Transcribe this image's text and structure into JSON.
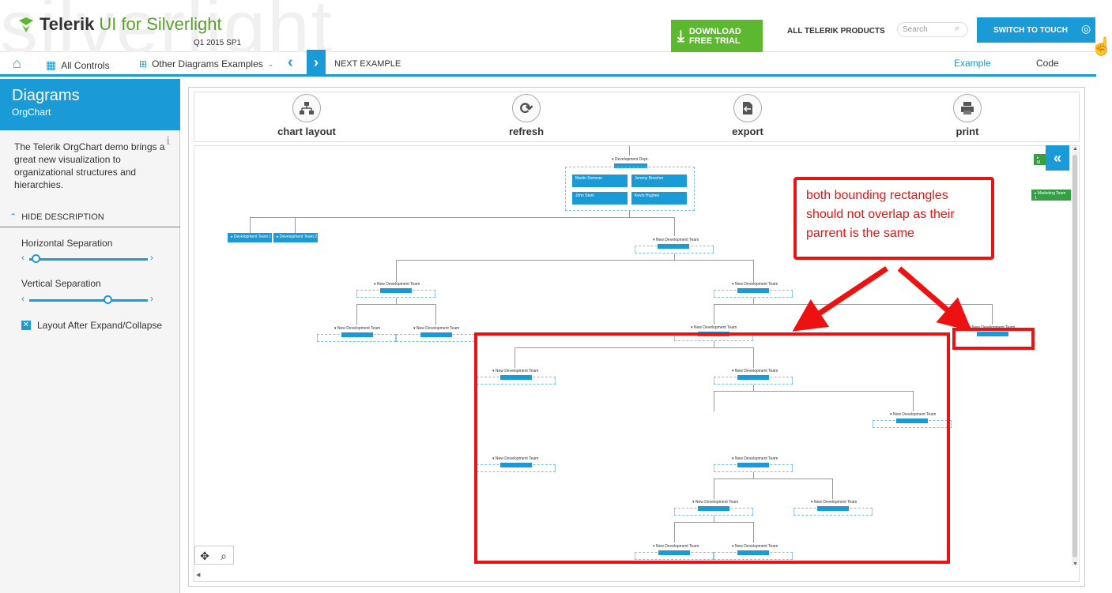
{
  "header": {
    "watermark": "silverlight",
    "brand": "Telerik",
    "product": "UI for Silverlight",
    "release": "Q1 2015 SP1",
    "download_line1": "DOWNLOAD",
    "download_line2": "FREE TRIAL",
    "all_products": "ALL TELERIK PRODUCTS",
    "search_placeholder": "Search",
    "switch_touch": "SWITCH TO TOUCH"
  },
  "nav": {
    "all_controls": "All Controls",
    "other_examples": "Other Diagrams Examples",
    "next_example": "NEXT EXAMPLE",
    "tab_example": "Example",
    "tab_code": "Code"
  },
  "sidebar": {
    "title": "Diagrams",
    "subtitle": "OrgChart",
    "description": "The Telerik OrgChart demo brings a great new visualization to organizational structures and hierarchies.",
    "hide_description": "HIDE DESCRIPTION",
    "horizontal_label": "Horizontal Separation",
    "horizontal_value": 0.05,
    "vertical_label": "Vertical Separation",
    "vertical_value": 0.7,
    "layout_check_label": "Layout After Expand/Collapse",
    "layout_check_checked": true
  },
  "toolbar": {
    "chart_layout": "chart layout",
    "refresh": "refresh",
    "export": "export",
    "print": "print"
  },
  "diagram": {
    "root_label": "Development Dept.",
    "team1": "Development Team 1",
    "team2": "Development Team 2",
    "new_team": "New Development Team",
    "marketing": "Marketing Team 1",
    "people": [
      "Martin Sommer",
      "Jeremy Boucher",
      "John Steel",
      "Kevin Hughes"
    ]
  },
  "annotation": {
    "text": "both bounding rectangles should not overlap as their parrent is the same"
  },
  "colors": {
    "accent": "#1a9bd7",
    "green": "#5cb82e",
    "annotation_red": "#ee1111"
  }
}
